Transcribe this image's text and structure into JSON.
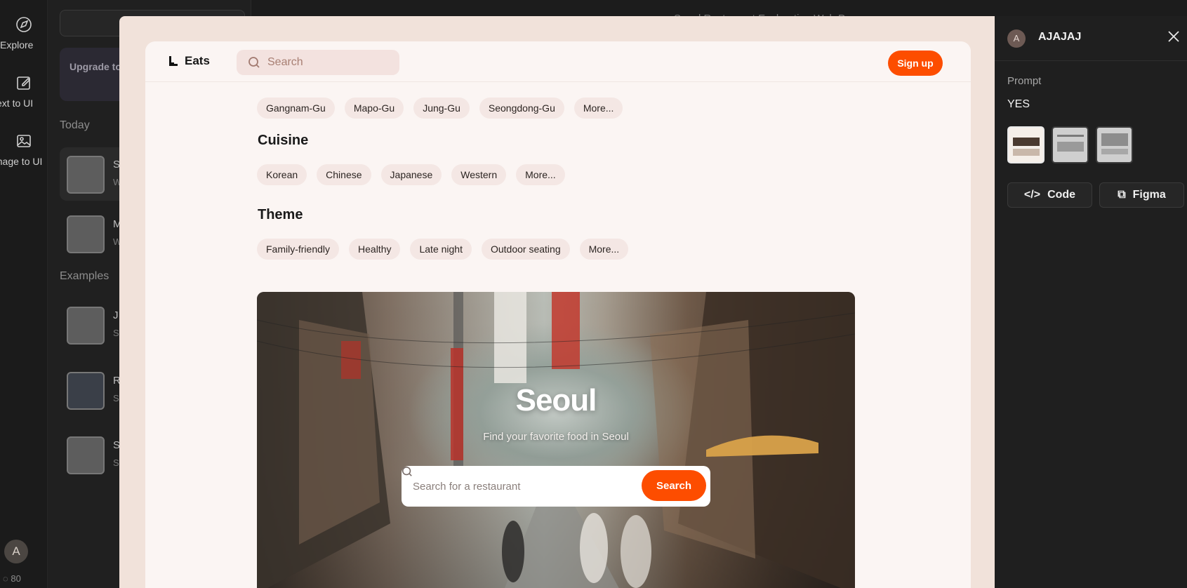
{
  "rail": {
    "items": [
      {
        "label": "Explore",
        "icon": "explore-icon"
      },
      {
        "label": "Text to UI",
        "icon": "edit-icon"
      },
      {
        "label": "Image to UI",
        "icon": "image-icon"
      }
    ],
    "avatar_initial": "A",
    "credits": "80"
  },
  "side": {
    "new_label": "+",
    "upgrade_text": "Upgrade to unlock full access",
    "today_label": "Today",
    "examples_label": "Examples",
    "today_items": [
      {
        "title": "S",
        "subtitle": "W"
      },
      {
        "title": "M",
        "subtitle": "W"
      }
    ],
    "example_items": [
      {
        "title": "J",
        "subtitle": "S"
      },
      {
        "title": "R",
        "subtitle": "S"
      },
      {
        "title": "S",
        "subtitle": "S"
      }
    ]
  },
  "background_title": "Seoul Restaurant Exploration Web Page",
  "preview": {
    "brand": "Eats",
    "search_placeholder": "Search",
    "signup_label": "Sign up",
    "location_chips": [
      "Gangnam-Gu",
      "Mapo-Gu",
      "Jung-Gu",
      "Seongdong-Gu",
      "More..."
    ],
    "cuisine_heading": "Cuisine",
    "cuisine_chips": [
      "Korean",
      "Chinese",
      "Japanese",
      "Western",
      "More..."
    ],
    "theme_heading": "Theme",
    "theme_chips": [
      "Family-friendly",
      "Healthy",
      "Late night",
      "Outdoor seating",
      "More..."
    ],
    "hero": {
      "title": "Seoul",
      "subtitle": "Find your favorite food in Seoul",
      "search_placeholder": "Search for a restaurant",
      "button_label": "Search"
    }
  },
  "panel": {
    "avatar_initial": "A",
    "user_name": "AJAJAJ",
    "prompt_label": "Prompt",
    "prompt_value": "YES",
    "code_label": "Code",
    "figma_label": "Figma"
  },
  "colors": {
    "accent": "#fd4d00",
    "chip_bg": "#f4e7e4",
    "modal_bg": "#f1e2da",
    "panel_bg": "#1f1f1f"
  }
}
